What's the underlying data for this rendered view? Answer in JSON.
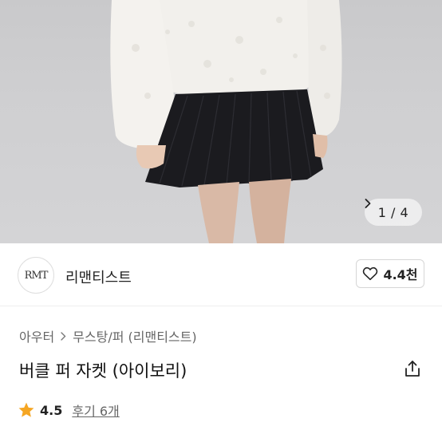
{
  "gallery": {
    "counter": "1 / 4",
    "icon": "chevron-right-icon",
    "current_index": 1,
    "total": 4
  },
  "brand": {
    "logo_text": "RMT",
    "name": "리맨티스트"
  },
  "like": {
    "icon": "heart-outline-icon",
    "count": "4.4천"
  },
  "breadcrumb": {
    "items": [
      "아우터",
      "무스탕/퍼 (리맨티스트)"
    ]
  },
  "product": {
    "title": "버클 퍼 자켓 (아이보리)"
  },
  "share": {
    "icon": "share-icon"
  },
  "rating": {
    "icon": "star-icon",
    "star_color": "#f5a623",
    "score": "4.5",
    "reviews": "후기 6개"
  }
}
